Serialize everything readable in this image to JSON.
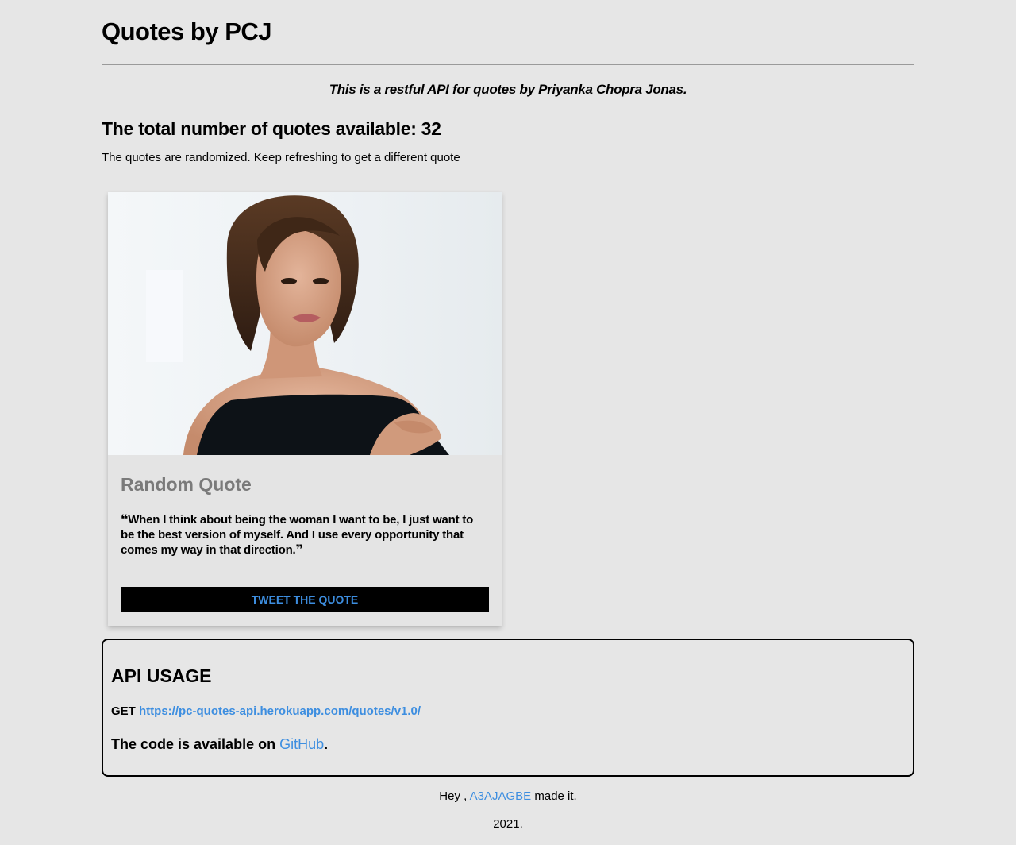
{
  "header": {
    "title": "Quotes by PCJ"
  },
  "intro": {
    "tagline": "This is a restful API for quotes by Priyanka Chopra Jonas.",
    "count_label": "The total number of quotes available: ",
    "count_value": "32",
    "note": "The quotes are randomized. Keep refreshing to get a different quote"
  },
  "card": {
    "title": "Random Quote",
    "open_quote": "❝",
    "close_quote": "❞",
    "quote": "When I think about being the woman I want to be, I just want to be the best version of myself. And I use every opportunity that comes my way in that direction.",
    "tweet_label": "Tweet the quote"
  },
  "api": {
    "title": "API USAGE",
    "method": "GET",
    "endpoint": "https://pc-quotes-api.herokuapp.com/quotes/v1.0/",
    "code_prefix": "The code is available on ",
    "code_link": "GitHub",
    "code_suffix": "."
  },
  "footer": {
    "prefix": "Hey , ",
    "author": "A3AJAGBE",
    "suffix": " made it.",
    "year": "2021."
  },
  "colors": {
    "background": "#e6e6e6",
    "link": "#3d8ee0",
    "button_bg": "#000000",
    "card_title": "#7a7a7a"
  }
}
